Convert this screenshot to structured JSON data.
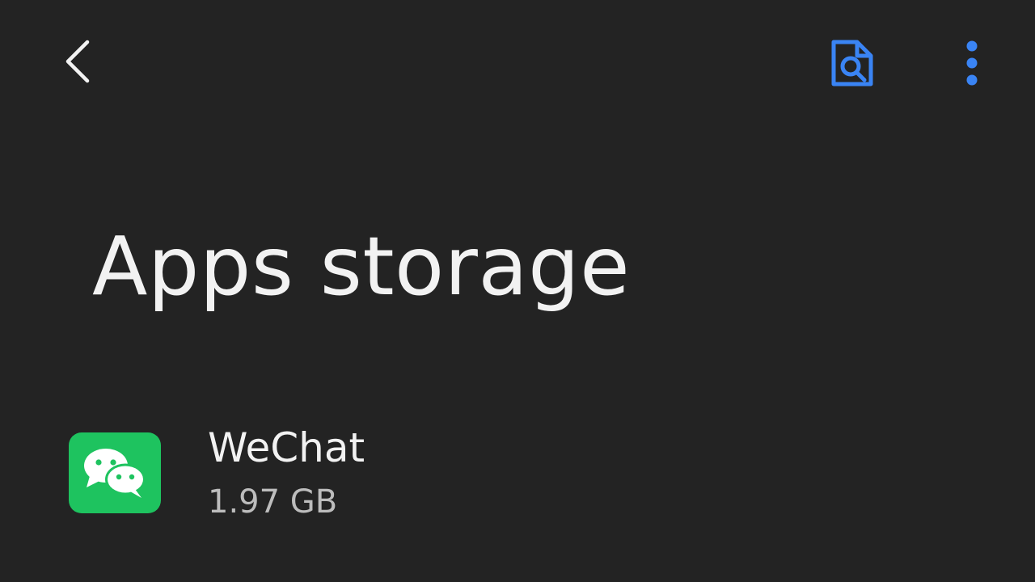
{
  "header": {
    "back_icon": "chevron-left-icon",
    "search_icon": "document-search-icon",
    "more_icon": "more-vertical-icon",
    "accent_color": "#3a84f4"
  },
  "page": {
    "title": "Apps storage"
  },
  "apps": [
    {
      "name": "WeChat",
      "size": "1.97 GB",
      "icon": "wechat-icon",
      "icon_color": "#1ec35f"
    }
  ]
}
